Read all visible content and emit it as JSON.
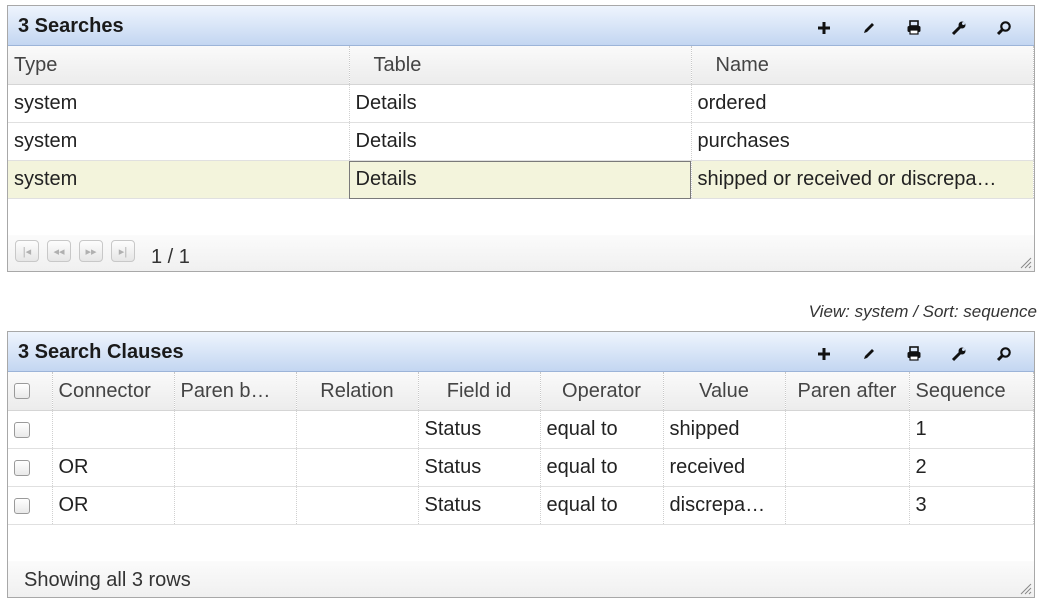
{
  "searches": {
    "title": "3 Searches",
    "toolbar": [
      "add-icon",
      "edit-icon",
      "print-icon",
      "settings-wrench-icon",
      "search-icon"
    ],
    "columns": [
      "Type",
      "Table",
      "Name"
    ],
    "rows": [
      [
        "system",
        "Details",
        "ordered"
      ],
      [
        "system",
        "Details",
        "purchases"
      ],
      [
        "system",
        "Details",
        "shipped or received or discrepa…"
      ]
    ],
    "pager": {
      "text": "1 / 1"
    }
  },
  "view_info": "View: system / Sort: sequence",
  "clauses": {
    "title": "3 Search Clauses",
    "toolbar": [
      "add-icon",
      "edit-icon",
      "print-icon",
      "settings-wrench-icon",
      "search-icon"
    ],
    "columns": [
      "Connector",
      "Paren b…",
      "Relation",
      "Field id",
      "Operator",
      "Value",
      "Paren after",
      "Sequence"
    ],
    "rows": [
      [
        "",
        "",
        "",
        "Status",
        "equal to",
        "shipped",
        "",
        "1"
      ],
      [
        "OR",
        "",
        "",
        "Status",
        "equal to",
        "received",
        "",
        "2"
      ],
      [
        "OR",
        "",
        "",
        "Status",
        "equal to",
        "discrepa…",
        "",
        "3"
      ]
    ],
    "footer": "Showing all 3 rows"
  },
  "colors": {
    "selected_row": "#f3f4dc",
    "titlebar": "#c3d6f1"
  }
}
